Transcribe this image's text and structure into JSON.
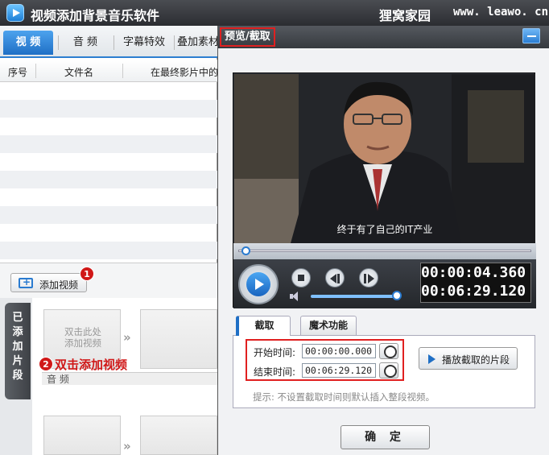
{
  "app": {
    "title": "视频添加背景音乐软件",
    "site_name": "狸窝家园",
    "site_url": "www. leawo. cn"
  },
  "left_panel": {
    "tabs": [
      {
        "label": "视 频",
        "active": true
      },
      {
        "label": "音 频",
        "active": false
      },
      {
        "label": "字幕特效",
        "active": false
      },
      {
        "label": "叠加素材",
        "active": false
      }
    ],
    "table_headers": [
      "序号",
      "文件名",
      "在最终影片中的"
    ],
    "add_button_label": "添加视频",
    "badge_1": "1",
    "side_tab_label": "已添加片段",
    "slot_hint": "双击此处\n添加视频",
    "badge_2": "2",
    "hint_double_click": "双击添加视频",
    "audio_label": "音 频"
  },
  "right_panel": {
    "title": "预览/截取",
    "subtitle": "终于有了自己的IT产业",
    "current_time": "00:00:04.360",
    "total_time": "00:06:29.120",
    "playback_progress": 0.011,
    "volume_level": 1.0,
    "cut_tabs": [
      {
        "label": "截取",
        "active": true
      },
      {
        "label": "魔术功能",
        "active": false
      }
    ],
    "start_label": "开始时间:",
    "start_value": "00:00:00.000",
    "end_label": "结束时间:",
    "end_value": "00:06:29.120",
    "play_clip_label": "播放截取的片段",
    "tip": "提示: 不设置截取时间则默认插入整段视频。",
    "ok_label": "确 定"
  },
  "colors": {
    "accent_blue": "#1f6fc5",
    "highlight_red": "#e02020"
  }
}
